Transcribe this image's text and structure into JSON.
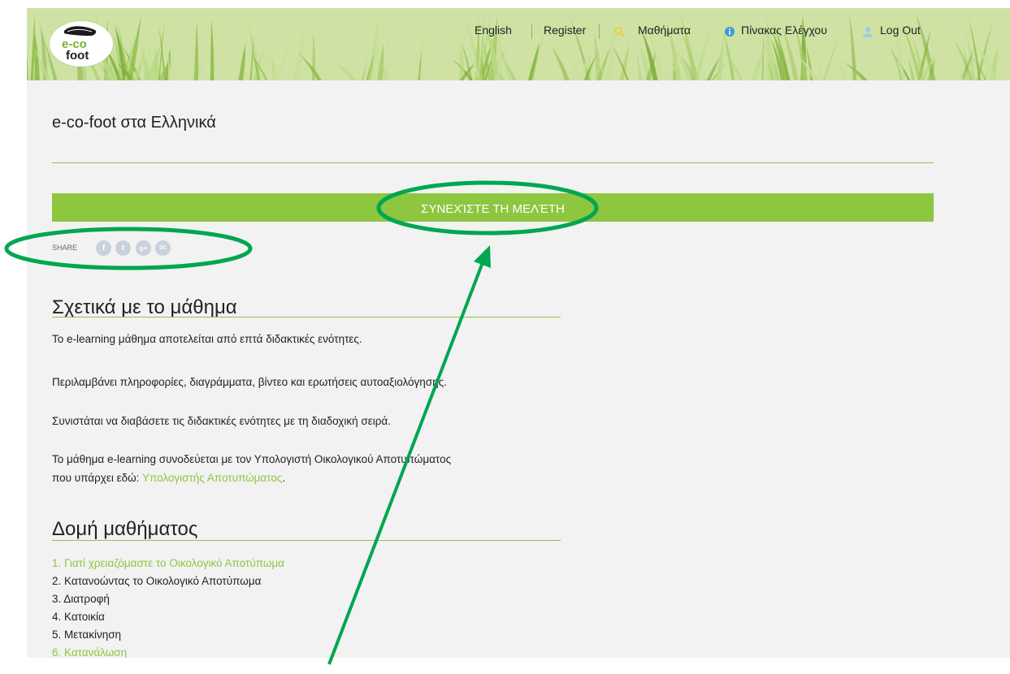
{
  "header": {
    "logo": {
      "line1": "e-co",
      "line2": "foot"
    },
    "nav": {
      "language": "English",
      "register": "Register",
      "courses": "Μαθήματα",
      "dashboard": "Πίνακας Ελέγχου",
      "logout": "Log Out"
    }
  },
  "main": {
    "title": "e-co-foot στα Ελληνικά",
    "continue_label": "ΣΥΝΕΧΊΣΤΕ ΤΗ ΜΕΛΈΤΗ",
    "share": {
      "label": "SHARE",
      "buttons": [
        "f",
        "t",
        "g+",
        "✉"
      ]
    },
    "about": {
      "title": "Σχετικά με το μάθημα",
      "p1": "Το e-learning μάθημα αποτελείται από επτά διδακτικές ενότητες.",
      "p2": "Περιλαμβάνει πληροφορίες, διαγράμματα, βίντεο και ερωτήσεις αυτοαξιολόγησης.",
      "p3": "Συνιστάται να διαβάσετε τις διδακτικές ενότητες με τη διαδοχική σειρά.",
      "p4_line1": "Το μάθημα e-learning συνοδεύεται με τον Υπολογιστή Οικολογικού Αποτυπώματος",
      "p4_line2_prefix": "που υπάρχει εδώ: ",
      "p4_link": "Υπολογιστής Αποτυπώματος",
      "p4_suffix": "."
    },
    "structure": {
      "title": "Δομή μαθήματος",
      "items": [
        "1. Γιατί χρειαζόμαστε το Οικολογικό Αποτύπωμα",
        "2. Κατανοώντας το Οικολογικό Αποτύπωμα",
        "3. Διατροφή",
        "4. Κατοικία",
        "5. Μετακίνηση",
        "6. Κατανάλωση"
      ]
    }
  },
  "colors": {
    "accent": "#8dc63f",
    "header_bg": "#cfe2a4",
    "page_bg": "#f2f2f2",
    "annotation": "#00a651"
  },
  "icons": [
    "search-icon",
    "info-icon",
    "user-icon",
    "shoe-logo-icon",
    "facebook-icon",
    "twitter-icon",
    "google-plus-icon",
    "email-icon"
  ]
}
